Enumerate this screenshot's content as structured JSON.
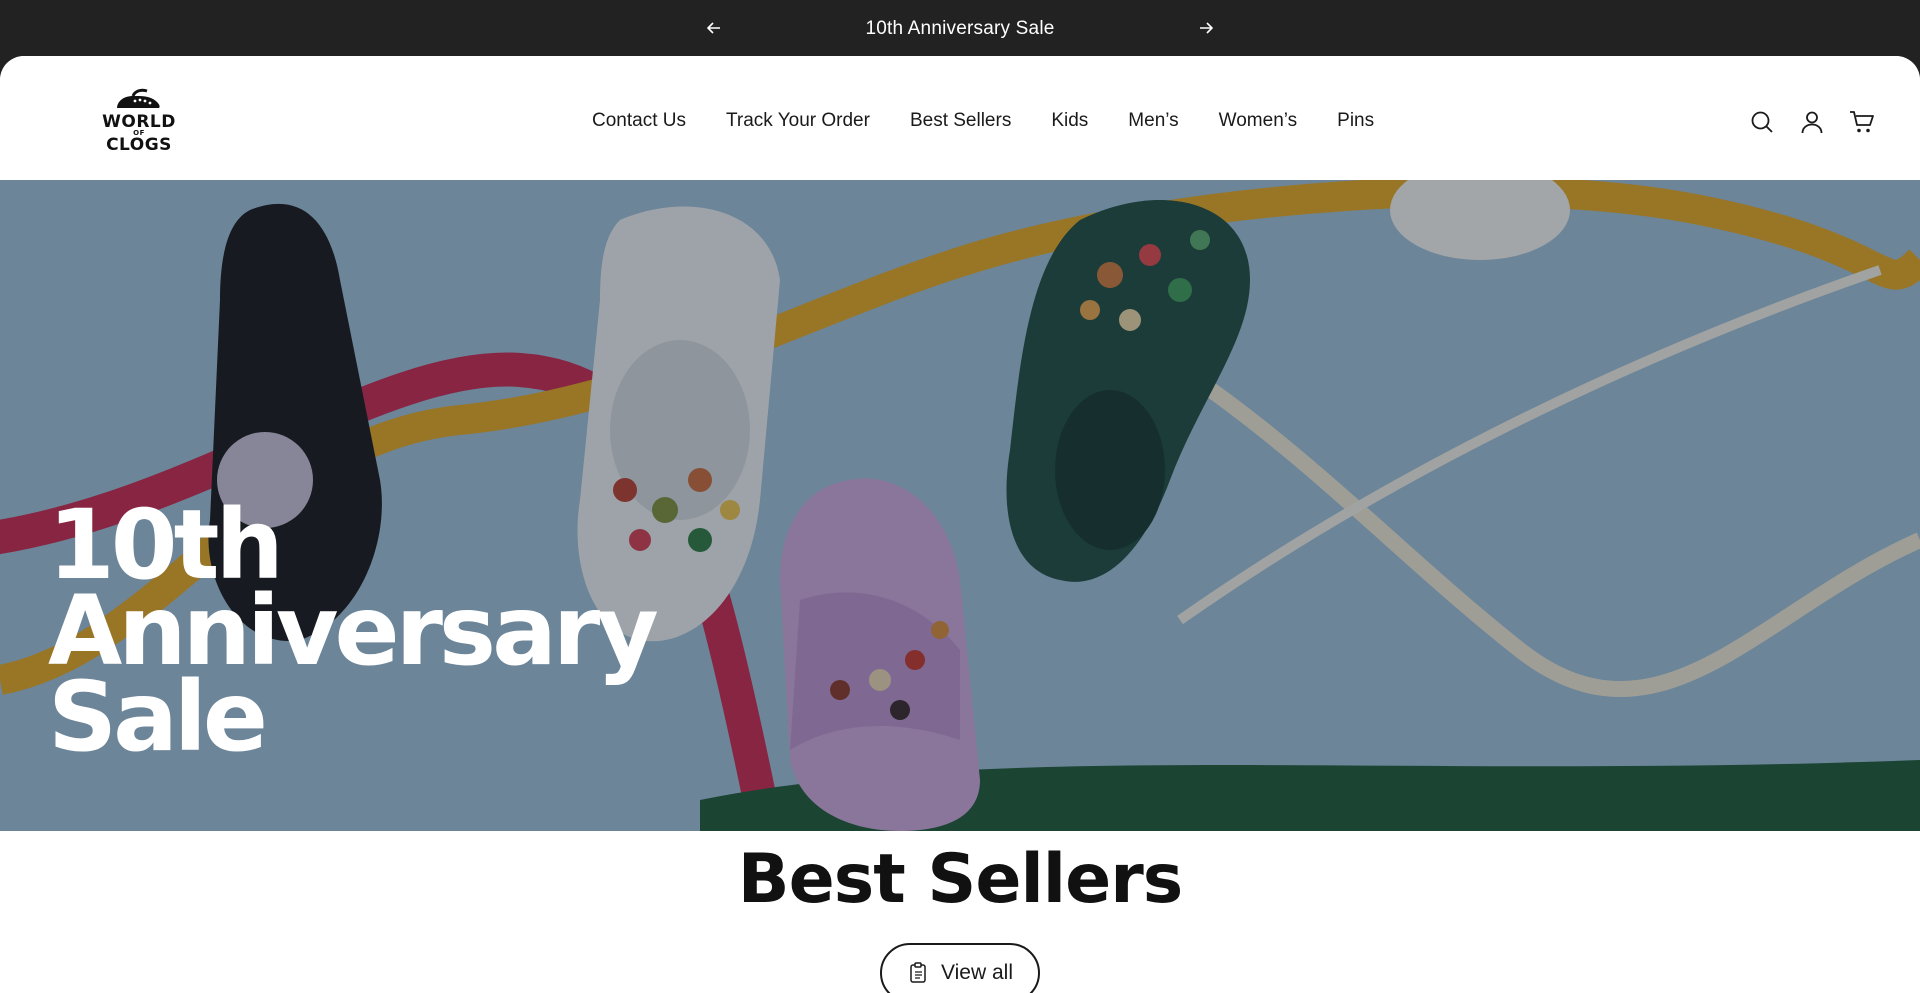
{
  "announcement": {
    "text": "10th Anniversary Sale",
    "prev_icon": "arrow-left-icon",
    "next_icon": "arrow-right-icon"
  },
  "header": {
    "logo": {
      "line1": "WORLD",
      "line2": "OF",
      "line3": "CLOGS"
    },
    "nav": [
      {
        "label": "Contact Us"
      },
      {
        "label": "Track Your Order"
      },
      {
        "label": "Best Sellers"
      },
      {
        "label": "Kids"
      },
      {
        "label": "Men’s"
      },
      {
        "label": "Women’s"
      },
      {
        "label": "Pins"
      }
    ],
    "icons": [
      "search-icon",
      "account-icon",
      "cart-icon"
    ]
  },
  "hero": {
    "title_line1": "10th",
    "title_line2": "Anniversary",
    "title_line3": "Sale"
  },
  "best_sellers": {
    "title": "Best Sellers",
    "view_all_label": "View all",
    "view_all_icon": "list-icon"
  },
  "colors": {
    "announcement_bg": "#222222",
    "hero_bg": "#8fb0c6",
    "text": "#1a1a1a",
    "white": "#ffffff"
  }
}
